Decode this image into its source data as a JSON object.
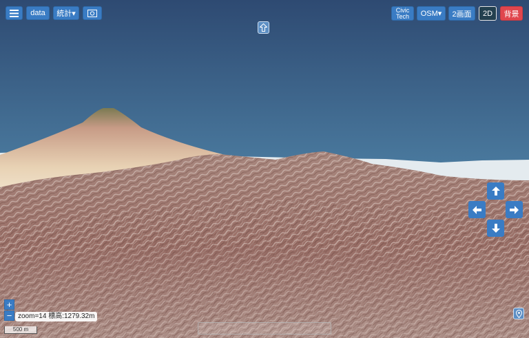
{
  "toolbar": {
    "menu_icon": "hamburger-icon",
    "data_label": "data",
    "stats_label": "統計▾",
    "screenshot_icon": "camera-icon"
  },
  "right_toolbar": {
    "civic_line1": "Civic",
    "civic_line2": "Tech",
    "osm_label": "OSM▾",
    "dual_label": "2画面",
    "mode_2d_label": "2D",
    "background_label": "背景"
  },
  "north_button_icon": "north-arrow-icon",
  "status": {
    "info_text": "zoom=14  標高:1279.32m",
    "scale_text": "500 m"
  },
  "zoom": {
    "in": "+",
    "out": "−"
  },
  "nav": {
    "up_icon": "arrow-up-icon",
    "down_icon": "arrow-down-icon",
    "left_icon": "arrow-left-icon",
    "right_icon": "arrow-right-icon"
  },
  "location_icon": "map-pin-icon",
  "colors": {
    "button_blue": "#3a7cc4",
    "button_red": "#e0464d",
    "sky_top": "#2e4a72",
    "sky_bottom": "#7fb3cf"
  }
}
